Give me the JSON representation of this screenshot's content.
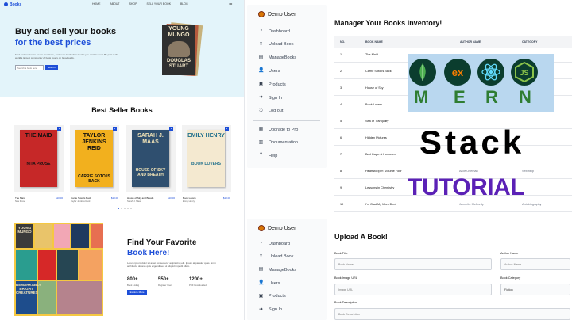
{
  "store": {
    "logo": "Books",
    "nav": [
      "HOME",
      "ABOUT",
      "SHOP",
      "SELL YOUR BOOK",
      "BLOG"
    ],
    "hero_line1": "Buy and sell your books",
    "hero_line2": "for the best prices",
    "hero_text": "Find and read more books you'll love, and keep track of the books you want to read. Be part of the world's largest community of book lovers on Goodreads.",
    "search_placeholder": "Search a book here",
    "search_btn": "Search",
    "hero_cover": {
      "title": "YOUNG MUNGO",
      "author": "DOUGLAS STUART"
    },
    "best_seller_title": "Best Seller Books",
    "books": [
      {
        "cover_title": "THE MAID",
        "cover_author": "NITA PROSE",
        "title": "The Maid",
        "author": "Nita Prose",
        "price": "$10.00",
        "bg": "#c62828",
        "fg": "#111"
      },
      {
        "cover_title": "TAYLOR JENKINS REID",
        "cover_author": "CARRIE SOTO IS BACK",
        "title": "Carrie Soto Is Back",
        "author": "Taylor Jenkins Reid",
        "price": "$10.00",
        "bg": "#f2b01e",
        "fg": "#111"
      },
      {
        "cover_title": "SARAH J. MAAS",
        "cover_author": "HOUSE OF SKY AND BREATH",
        "title": "House of Sky and Breath",
        "author": "Sarah J. Maas",
        "price": "$10.00",
        "bg": "#2f4f6f",
        "fg": "#f0e2b6"
      },
      {
        "cover_title": "EMILY HENRY",
        "cover_author": "BOOK LOVERS",
        "title": "Book Lovers",
        "author": "Emily Henry",
        "price": "$10.00",
        "bg": "#f4e9d0",
        "fg": "#1f6f8b"
      }
    ],
    "fav_line1": "Find Your Favorite",
    "fav_line2": "Book Here!",
    "fav_text": "Lorem ipsum dolor sit amet consectetur adipisicing elit. Ipsum at pariatur quas. Enim architecto dolores quis eligendi sed ut aliquid impedit ullam.",
    "stats": [
      {
        "num": "800+",
        "label": "Book Listing"
      },
      {
        "num": "550+",
        "label": "Register User"
      },
      {
        "num": "1200+",
        "label": "PDF Downloaded"
      }
    ],
    "explore_btn": "Explore More",
    "collage": [
      {
        "text": "YOUNG MUNGO",
        "bg": "#3b3b3b",
        "fg": "#f2e6c7"
      },
      {
        "text": "",
        "bg": "#e9c46a",
        "fg": "#111"
      },
      {
        "text": "",
        "bg": "#f2a7b5",
        "fg": "#111"
      },
      {
        "text": "",
        "bg": "#1e3a5f",
        "fg": "#fff"
      },
      {
        "text": "",
        "bg": "#e76f51",
        "fg": "#fff"
      },
      {
        "text": "",
        "bg": "#2a9d8f",
        "fg": "#fff"
      },
      {
        "text": "",
        "bg": "#d62828",
        "fg": "#fff"
      },
      {
        "text": "",
        "bg": "#264653",
        "fg": "#fff"
      },
      {
        "text": "",
        "bg": "#f4a261",
        "fg": "#111"
      },
      {
        "text": "",
        "bg": "#8ab17d",
        "fg": "#111"
      },
      {
        "text": "REMARKABLY BRIGHT CREATURES",
        "bg": "#1e4d8c",
        "fg": "#f5e6b8"
      },
      {
        "text": "",
        "bg": "#b5838d",
        "fg": "#fff"
      }
    ]
  },
  "dashboard": {
    "user": "Demo User",
    "menu": [
      "Dashboard",
      "Upload Book",
      "ManageBooks",
      "Users",
      "Products",
      "Sign In",
      "Log out"
    ],
    "menu_icons": [
      "dashboard-icon",
      "upload-icon",
      "manage-books-icon",
      "users-icon",
      "products-icon",
      "sign-in-icon",
      "log-out-icon"
    ],
    "extra_menu": [
      "Upgrade to Pro",
      "Documentation",
      "Help"
    ],
    "extra_icons": [
      "upgrade-icon",
      "documentation-icon",
      "help-icon"
    ],
    "manage_title": "Manager Your Books Inventory!",
    "columns": [
      "NO.",
      "BOOK NAME",
      "AUTHOR NAME",
      "CATEGORY"
    ],
    "rows": [
      {
        "no": "1",
        "name": "The Maid",
        "author": "",
        "category": ""
      },
      {
        "no": "2",
        "name": "Carrie Soto Is Back",
        "author": "",
        "category": ""
      },
      {
        "no": "3",
        "name": "House of Sky",
        "author": "",
        "category": ""
      },
      {
        "no": "4",
        "name": "Book Lovers",
        "author": "",
        "category": ""
      },
      {
        "no": "5",
        "name": "Sea of Tranquility",
        "author": "",
        "category": ""
      },
      {
        "no": "6",
        "name": "Hidden Pictures",
        "author": "",
        "category": ""
      },
      {
        "no": "7",
        "name": "Bad Gays: A Homosex",
        "author": "",
        "category": ""
      },
      {
        "no": "8",
        "name": "Heartstopper: Volume Four",
        "author": "Alice Oseman",
        "category": "Self-help"
      },
      {
        "no": "9",
        "name": "Lessons in Chemistry",
        "author": "",
        "category": ""
      },
      {
        "no": "10",
        "name": "I'm Glad My Mom Died",
        "author": "Jennette McCurdy",
        "category": "Autobiography"
      }
    ],
    "upload_user": "Demo User",
    "upload_menu": [
      "Dashboard",
      "Upload Book",
      "ManageBooks",
      "Users",
      "Products",
      "Sign In"
    ],
    "upload_title": "Upload A Book!",
    "fields": {
      "book_title_label": "Book Title",
      "book_title_ph": "Book Name",
      "author_label": "Author Name",
      "author_ph": "Author Name",
      "image_label": "Book Image URL",
      "image_ph": "Image URL",
      "category_label": "Book Category",
      "category_value": "Fiction",
      "desc_label": "Book Description",
      "desc_ph": "Book Description"
    }
  },
  "overlay": {
    "mern_letters": [
      "M",
      "E",
      "R",
      "N"
    ],
    "logos": [
      "mongodb-logo",
      "express-logo",
      "react-logo",
      "nodejs-logo"
    ],
    "express_text": "ex",
    "stack": "Stack",
    "tutorial": "TUTORIAL"
  }
}
